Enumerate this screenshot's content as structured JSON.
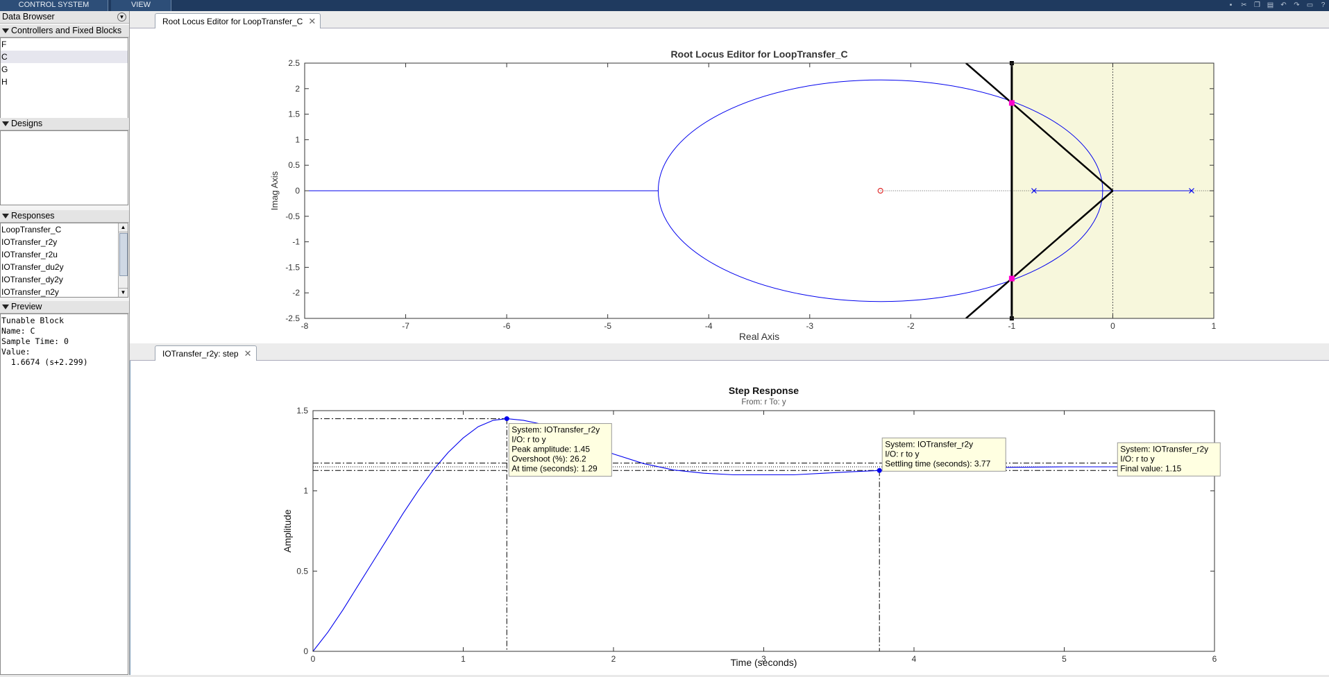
{
  "toolstrip": {
    "tabs": [
      "CONTROL SYSTEM",
      "VIEW"
    ],
    "icons": [
      "save-icon",
      "cut-icon",
      "copy-icon",
      "paste-icon",
      "undo-icon",
      "redo-icon",
      "layout-icon",
      "help-icon"
    ]
  },
  "data_browser": {
    "title": "Data Browser",
    "controllers": {
      "header": "Controllers and Fixed Blocks",
      "items": [
        "F",
        "C",
        "G",
        "H"
      ],
      "selected": "C"
    },
    "designs": {
      "header": "Designs"
    },
    "responses": {
      "header": "Responses",
      "items": [
        "LoopTransfer_C",
        "IOTransfer_r2y",
        "IOTransfer_r2u",
        "IOTransfer_du2y",
        "IOTransfer_dy2y",
        "IOTransfer_n2y"
      ]
    },
    "preview": {
      "header": "Preview",
      "lines": [
        "Tunable Block",
        "Name: C",
        "Sample Time: 0",
        "Value:",
        "  1.6674 (s+2.299)"
      ]
    }
  },
  "top_tab": {
    "label": "Root Locus Editor for LoopTransfer_C"
  },
  "bottom_tab": {
    "label": "IOTransfer_r2y: step"
  },
  "colors": {
    "locus": "#0000ee",
    "region": "#f7f7dc",
    "closed_loop_pole": "#ff00cc",
    "zero": "#e03030"
  },
  "chart_data": [
    {
      "type": "scatter",
      "title": "Root Locus Editor for LoopTransfer_C",
      "xlabel": "Real Axis",
      "ylabel": "Imag Axis",
      "xlim": [
        -8,
        1
      ],
      "ylim": [
        -2.5,
        2.5
      ],
      "xticks": [
        "-8",
        "-7",
        "-6",
        "-5",
        "-4",
        "-3",
        "-2",
        "-1",
        "0",
        "1"
      ],
      "yticks": [
        "2.5",
        "2",
        "1.5",
        "1",
        "0.5",
        "0",
        "-0.5",
        "-1",
        "-1.5",
        "-2",
        "-2.5"
      ],
      "open_loop_poles": [
        [
          -0.78,
          0
        ],
        [
          0.78,
          0
        ]
      ],
      "open_loop_zeros": [
        [
          -2.3,
          0
        ]
      ],
      "closed_loop_poles": [
        [
          -1.0,
          1.72
        ],
        [
          -1.0,
          -1.72
        ]
      ],
      "locus_ellipse": {
        "center": [
          -2.3,
          0
        ],
        "real_half_width": 2.2,
        "imag_half_height": 2.17
      },
      "real_axis_locus": [
        -8,
        -4.5
      ],
      "design_constraints": {
        "settling_boundary_x": -1.0,
        "damping_apex": [
          0,
          0
        ],
        "damping_slope": 1.72
      }
    },
    {
      "type": "line",
      "title": "Step Response",
      "subtitle": "From: r  To: y",
      "xlabel": "Time (seconds)",
      "ylabel": "Amplitude",
      "xlim": [
        0,
        6
      ],
      "ylim": [
        0,
        1.5
      ],
      "xticks": [
        "0",
        "1",
        "2",
        "3",
        "4",
        "5",
        "6"
      ],
      "yticks": [
        "0",
        "0.5",
        "1",
        "1.5"
      ],
      "final_value": 1.15,
      "settling_band": [
        1.127,
        1.173
      ],
      "series": [
        {
          "x": [
            0,
            0.1,
            0.2,
            0.3,
            0.4,
            0.5,
            0.6,
            0.7,
            0.8,
            0.9,
            1.0,
            1.1,
            1.2,
            1.29,
            1.4,
            1.5,
            1.6,
            1.8,
            2.0,
            2.2,
            2.4,
            2.6,
            2.8,
            3.0,
            3.2,
            3.4,
            3.6,
            3.77,
            4.0,
            4.5,
            5.0,
            5.5,
            6.0
          ],
          "values": [
            0,
            0.12,
            0.26,
            0.41,
            0.56,
            0.71,
            0.86,
            1.0,
            1.13,
            1.24,
            1.33,
            1.4,
            1.44,
            1.45,
            1.44,
            1.42,
            1.38,
            1.3,
            1.23,
            1.17,
            1.13,
            1.11,
            1.1,
            1.1,
            1.1,
            1.11,
            1.12,
            1.127,
            1.135,
            1.145,
            1.15,
            1.15,
            1.15
          ]
        }
      ],
      "annotations": [
        {
          "lines": [
            "System: IOTransfer_r2y",
            "I/O: r to y",
            "Peak amplitude: 1.45",
            "Overshoot (%): 26.2",
            "At time (seconds): 1.29"
          ]
        },
        {
          "lines": [
            "System: IOTransfer_r2y",
            "I/O: r to y",
            "Settling time (seconds): 3.77"
          ]
        },
        {
          "lines": [
            "System: IOTransfer_r2y",
            "I/O: r to y",
            "Final value: 1.15"
          ]
        }
      ]
    }
  ]
}
